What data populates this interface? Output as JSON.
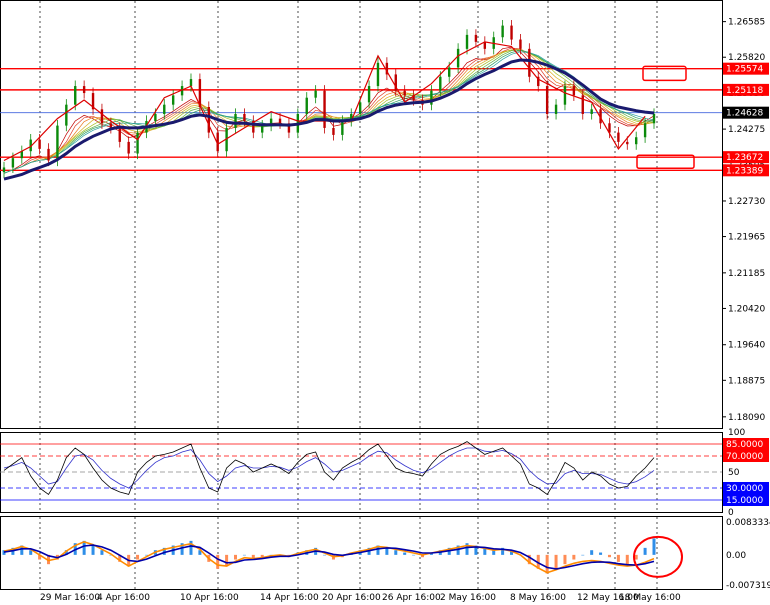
{
  "chart_data": {
    "type": "line",
    "main": {
      "ylim": [
        1.1785,
        1.2705
      ],
      "y_ticks": [
        "1.26585",
        "1.25820",
        "1.25050",
        "1.24275",
        "1.23505",
        "1.22730",
        "1.21965",
        "1.21185",
        "1.20420",
        "1.19640",
        "1.18875",
        "1.18090"
      ],
      "badges": [
        {
          "label": "1.25574",
          "value": 1.25574,
          "color": "#ff0000"
        },
        {
          "label": "1.25118",
          "value": 1.25118,
          "color": "#ff0000"
        },
        {
          "label": "1.24628",
          "value": 1.24628,
          "color": "#000000"
        },
        {
          "label": "1.23672",
          "value": 1.23672,
          "color": "#ff0000"
        },
        {
          "label": "1.23389",
          "value": 1.23389,
          "color": "#ff0000"
        }
      ],
      "levels": [
        1.25574,
        1.25118,
        1.23672,
        1.23389
      ],
      "current_price": 1.24628,
      "x": [
        0,
        3,
        6,
        9,
        12,
        15,
        18,
        21,
        24,
        27,
        30,
        33,
        36,
        39,
        42,
        45,
        48,
        51,
        54,
        57,
        60,
        63,
        66,
        69,
        72,
        75,
        78,
        81,
        84,
        87,
        90,
        93,
        96,
        99,
        102,
        105,
        108,
        111,
        114,
        117,
        120,
        123,
        126,
        129,
        132,
        135,
        138,
        141,
        144,
        147,
        150,
        153,
        156,
        159,
        162,
        165,
        168,
        171,
        174,
        177,
        180,
        183,
        186,
        189,
        192,
        195,
        198,
        201,
        204,
        207,
        210,
        213,
        216,
        219
      ],
      "close": [
        1.2345,
        1.2365,
        1.238,
        1.2405,
        1.2385,
        1.236,
        1.2435,
        1.248,
        1.252,
        1.2505,
        1.247,
        1.244,
        1.243,
        1.24,
        1.2375,
        1.242,
        1.2445,
        1.246,
        1.248,
        1.25,
        1.252,
        1.2535,
        1.2475,
        1.242,
        1.238,
        1.243,
        1.246,
        1.2445,
        1.242,
        1.2435,
        1.245,
        1.244,
        1.242,
        1.246,
        1.2495,
        1.251,
        1.243,
        1.2415,
        1.2445,
        1.246,
        1.2485,
        1.252,
        1.257,
        1.2545,
        1.251,
        1.25,
        1.249,
        1.248,
        1.251,
        1.254,
        1.256,
        1.26,
        1.263,
        1.2615,
        1.26,
        1.2625,
        1.265,
        1.262,
        1.26,
        1.254,
        1.252,
        1.246,
        1.248,
        1.252,
        1.25,
        1.246,
        1.247,
        1.244,
        1.242,
        1.24,
        1.2395,
        1.241,
        1.244,
        1.246
      ],
      "ma": [
        1.232,
        1.2325,
        1.233,
        1.2338,
        1.2345,
        1.2352,
        1.2362,
        1.2375,
        1.239,
        1.2402,
        1.2412,
        1.242,
        1.2428,
        1.2432,
        1.243,
        1.243,
        1.2432,
        1.2435,
        1.2438,
        1.2442,
        1.2448,
        1.2455,
        1.2458,
        1.2455,
        1.2448,
        1.2442,
        1.244,
        1.244,
        1.2438,
        1.2437,
        1.2437,
        1.2437,
        1.2436,
        1.2438,
        1.2442,
        1.2448,
        1.2448,
        1.2445,
        1.2445,
        1.2447,
        1.245,
        1.2456,
        1.2466,
        1.2474,
        1.2479,
        1.2482,
        1.2484,
        1.2485,
        1.2488,
        1.2494,
        1.2502,
        1.2512,
        1.2525,
        1.2536,
        1.2545,
        1.2553,
        1.2563,
        1.2572,
        1.2576,
        1.2575,
        1.2571,
        1.2565,
        1.2557,
        1.2548,
        1.2536,
        1.2522,
        1.2507,
        1.2492,
        1.2482,
        1.2475,
        1.2471,
        1.2467,
        1.2464,
        1.2462
      ]
    },
    "oscillator": {
      "ylim": [
        0,
        100
      ],
      "y_ticks": [
        "100",
        "50",
        "0"
      ],
      "badges": [
        {
          "label": "85.0000",
          "value": 85,
          "color": "#ff0000"
        },
        {
          "label": "70.0000",
          "value": 70,
          "color": "#ff0000"
        },
        {
          "label": "30.0000",
          "value": 30,
          "color": "#0000ff"
        },
        {
          "label": "15.0000",
          "value": 15,
          "color": "#0000ff"
        }
      ],
      "levels": [
        85,
        70,
        50,
        30,
        15
      ],
      "fast": [
        52,
        60,
        68,
        45,
        30,
        22,
        40,
        68,
        80,
        72,
        55,
        40,
        30,
        25,
        22,
        50,
        62,
        70,
        72,
        75,
        80,
        85,
        55,
        30,
        25,
        55,
        65,
        60,
        50,
        55,
        60,
        55,
        48,
        62,
        72,
        75,
        50,
        40,
        55,
        62,
        68,
        78,
        85,
        70,
        55,
        50,
        48,
        45,
        60,
        72,
        78,
        82,
        88,
        80,
        72,
        76,
        80,
        70,
        60,
        35,
        30,
        22,
        40,
        62,
        55,
        40,
        50,
        45,
        35,
        30,
        32,
        45,
        55,
        68
      ],
      "slow": [
        55,
        58,
        62,
        55,
        45,
        35,
        38,
        55,
        70,
        72,
        65,
        52,
        42,
        35,
        30,
        40,
        52,
        62,
        68,
        70,
        75,
        78,
        65,
        48,
        38,
        45,
        55,
        58,
        55,
        55,
        57,
        56,
        52,
        56,
        63,
        68,
        60,
        50,
        52,
        57,
        62,
        70,
        76,
        74,
        65,
        58,
        52,
        49,
        54,
        62,
        70,
        76,
        80,
        80,
        76,
        75,
        77,
        73,
        66,
        52,
        42,
        35,
        36,
        48,
        52,
        48,
        48,
        47,
        42,
        37,
        35,
        38,
        44,
        52
      ]
    },
    "macd": {
      "ylim": [
        -0.0073193,
        0.0083334
      ],
      "y_ticks": [
        "0.0083334",
        "0.00",
        "-0.0073193"
      ],
      "hist": [
        0.001,
        0.0015,
        0.002,
        0.001,
        -0.001,
        -0.002,
        -0.001,
        0.001,
        0.0025,
        0.003,
        0.002,
        0.001,
        0.0,
        -0.0015,
        -0.0025,
        -0.001,
        0.0,
        0.001,
        0.0015,
        0.002,
        0.0025,
        0.003,
        0.001,
        -0.0015,
        -0.003,
        -0.0025,
        -0.001,
        0.0,
        -0.001,
        -0.0005,
        0.0,
        0.0,
        -0.0005,
        0.0005,
        0.001,
        0.0015,
        0.0,
        -0.001,
        -0.0005,
        0.0005,
        0.001,
        0.0015,
        0.002,
        0.0015,
        0.001,
        0.0005,
        0.0,
        -0.0005,
        0.0005,
        0.001,
        0.0015,
        0.002,
        0.0025,
        0.002,
        0.0015,
        0.001,
        0.0015,
        0.001,
        0.0,
        -0.002,
        -0.003,
        -0.004,
        -0.003,
        -0.002,
        -0.001,
        0.0,
        0.001,
        0.0005,
        -0.0005,
        -0.0015,
        -0.0025,
        -0.001,
        0.0015,
        0.0035
      ],
      "line": [
        0.0008,
        0.0012,
        0.0018,
        0.0012,
        0.0,
        -0.0012,
        -0.0008,
        0.0008,
        0.002,
        0.0028,
        0.0022,
        0.0012,
        0.0002,
        -0.0012,
        -0.0024,
        -0.0014,
        -0.0004,
        0.0006,
        0.0012,
        0.0016,
        0.002,
        0.0024,
        0.0012,
        -0.0008,
        -0.0022,
        -0.0024,
        -0.0014,
        -0.0006,
        -0.0008,
        -0.0006,
        -0.0002,
        0.0,
        -0.0003,
        0.0003,
        0.0008,
        0.0012,
        0.0004,
        -0.0004,
        -0.0002,
        0.0004,
        0.0008,
        0.0012,
        0.0018,
        0.0016,
        0.0012,
        0.0008,
        0.0004,
        0.0,
        0.0004,
        0.0008,
        0.0012,
        0.0016,
        0.002,
        0.0018,
        0.0014,
        0.001,
        0.0012,
        0.0008,
        0.0,
        -0.0016,
        -0.0028,
        -0.0038,
        -0.0032,
        -0.0024,
        -0.0018,
        -0.0014,
        -0.0012,
        -0.0014,
        -0.0018,
        -0.0022,
        -0.0024,
        -0.0022,
        -0.0016,
        -0.0008
      ],
      "signal": [
        0.0006,
        0.0009,
        0.0013,
        0.0013,
        0.0007,
        -0.0002,
        -0.0006,
        0.0001,
        0.0011,
        0.0019,
        0.0021,
        0.0017,
        0.001,
        -0.0001,
        -0.0012,
        -0.0014,
        -0.0009,
        -0.0002,
        0.0005,
        0.001,
        0.0015,
        0.0019,
        0.0016,
        0.0004,
        -0.0009,
        -0.0017,
        -0.0016,
        -0.0011,
        -0.001,
        -0.0008,
        -0.0005,
        -0.0003,
        -0.0003,
        0.0,
        0.0004,
        0.0008,
        0.0006,
        0.0001,
        -0.0001,
        0.0002,
        0.0005,
        0.0009,
        0.0013,
        0.0015,
        0.0014,
        0.0011,
        0.0008,
        0.0004,
        0.0004,
        0.0006,
        0.0009,
        0.0012,
        0.0016,
        0.0017,
        0.0016,
        0.0013,
        0.0012,
        0.001,
        0.0005,
        -0.0005,
        -0.0017,
        -0.0027,
        -0.003,
        -0.0027,
        -0.0023,
        -0.0019,
        -0.0016,
        -0.0015,
        -0.0016,
        -0.0019,
        -0.0021,
        -0.0022,
        -0.0019,
        -0.0014
      ]
    },
    "x_labels": [
      "29 Mar 16:00",
      "4 Apr 16:00",
      "10 Apr 16:00",
      "14 Apr 16:00",
      "20 Apr 16:00",
      "26 Apr 16:00",
      "2 May 16:00",
      "8 May 16:00",
      "12 May 16:00",
      "18 May 16:00"
    ],
    "colors": {
      "up": "#0a8a0a",
      "down": "#c00000",
      "ma": "#1a1a6e",
      "level": "#ff0000",
      "osc_fast": "#000000",
      "osc_slow": "#3333cc",
      "macd_line": "#ff8c00",
      "signal_line": "#0000aa",
      "hist_pos": "#2e8ee8",
      "hist_neg": "#ff8c55"
    }
  }
}
